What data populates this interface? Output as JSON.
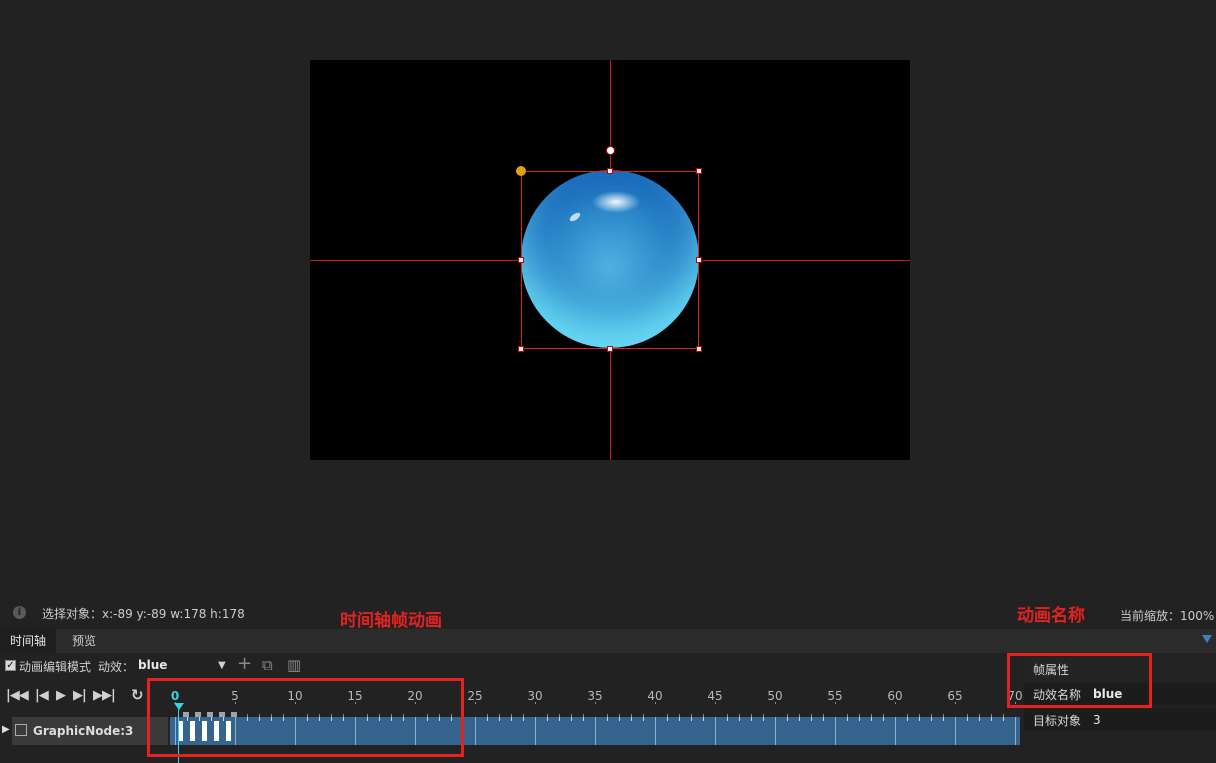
{
  "status": {
    "selection": "选择对象：x:-89 y:-89  w:178 h:178",
    "zoom": "当前缩放：100%",
    "annotation_timeline": "时间轴帧动画",
    "annotation_name": "动画名称"
  },
  "tabs": [
    {
      "label": "时间轴",
      "active": true
    },
    {
      "label": "预览",
      "active": false
    }
  ],
  "toolbar": {
    "edit_mode_label": "动画编辑模式",
    "effect_label": "动效：",
    "effect_value": "blue"
  },
  "ruler": {
    "current_frame": "0",
    "labels": [
      "5",
      "10",
      "15",
      "20",
      "25",
      "30",
      "35",
      "40",
      "45",
      "50",
      "55",
      "60",
      "65",
      "70"
    ]
  },
  "track": {
    "name": "GraphicNode:3",
    "keyframes": [
      1,
      2,
      3,
      4,
      5
    ]
  },
  "properties": {
    "header": "帧属性",
    "effect_name_label": "动效名称",
    "effect_name_value": "blue",
    "target_label": "目标对象",
    "target_value": "3"
  },
  "colors": {
    "accent_red": "#e32222",
    "playhead": "#33d4e4",
    "track": "#35658f"
  },
  "icons": [
    "info-icon",
    "first-frame-icon",
    "prev-frame-icon",
    "play-icon",
    "next-frame-icon",
    "last-frame-icon",
    "loop-icon",
    "add-icon",
    "copy-icon",
    "delete-icon",
    "expand-arrow-icon",
    "node-icon",
    "dropdown-icon"
  ]
}
